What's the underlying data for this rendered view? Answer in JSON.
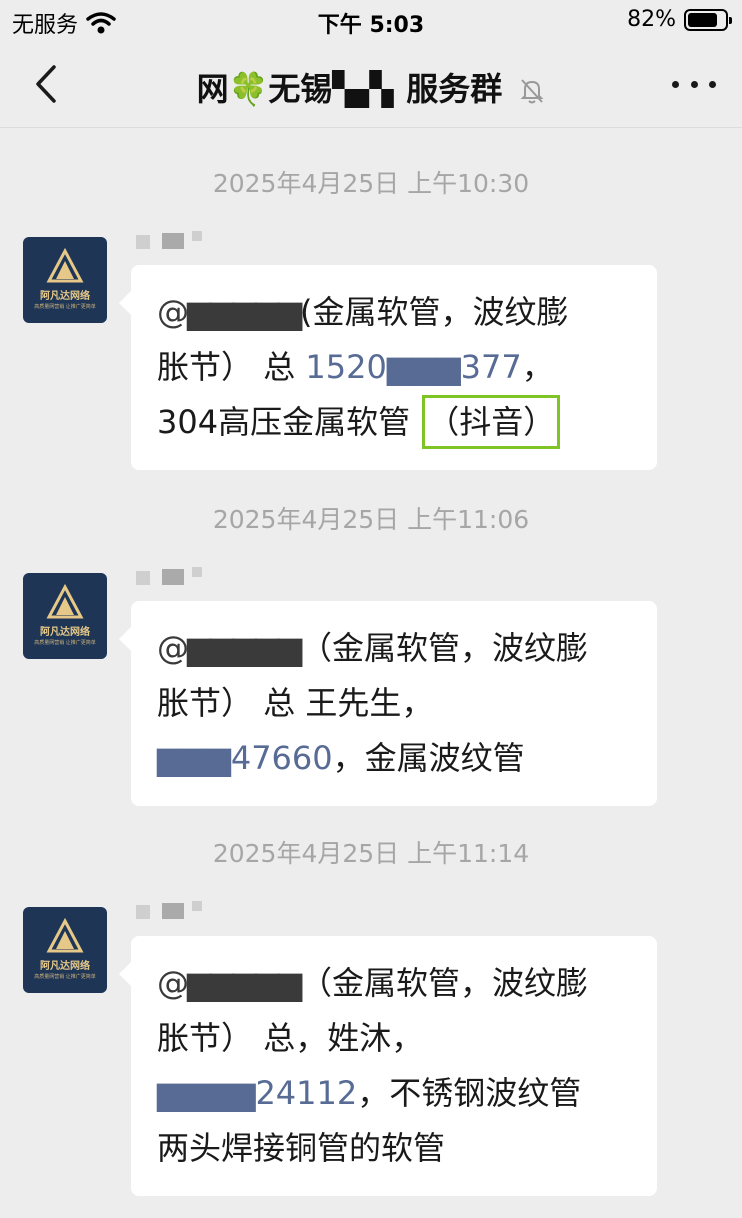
{
  "status_bar": {
    "carrier": "无服务",
    "time": "下午 5:03",
    "battery": "82%"
  },
  "header": {
    "title": "网🍀无锡▚▞▖服务群",
    "back_icon": "chevron-left-icon",
    "more_icon": "more-dots-icon",
    "mute_icon": "bell-muted-icon"
  },
  "avatar": {
    "name": "阿凡达网络",
    "sub": "高质量网营销 让推广更简单"
  },
  "messages": [
    {
      "timestamp": "2025年4月25日 上午10:30",
      "sender": "▚▞",
      "at": "@▆▆▆▆▆",
      "line1": "(金属软管，波纹膨",
      "line2_prefix": "胀节）",
      "line2_mid": "总 ",
      "phone": "1520▆▆▆377",
      "line2_suffix": "，",
      "line3": "304高压金属软管",
      "tag": "（抖音）"
    },
    {
      "timestamp": "2025年4月25日 上午11:06",
      "sender": "▚▞",
      "at": "@▆▆▆▆▆",
      "line1": "（金属软管，波纹膨",
      "line2_prefix": "胀节）",
      "line2_mid": "总 王先生，",
      "phone": "▆▆▆47660",
      "line3_suffix": "，金属波纹管"
    },
    {
      "timestamp": "2025年4月25日 上午11:14",
      "sender": "▚▞",
      "at": "@▆▆▆▆▆",
      "line1": "（金属软管，波纹膨",
      "line2_prefix": "胀节）",
      "line2_mid": "总，姓沐，",
      "phone": "▆▆▆▆24112",
      "line3_suffix": "，不锈钢波纹管",
      "line4": "两头焊接铜管的软管"
    }
  ]
}
